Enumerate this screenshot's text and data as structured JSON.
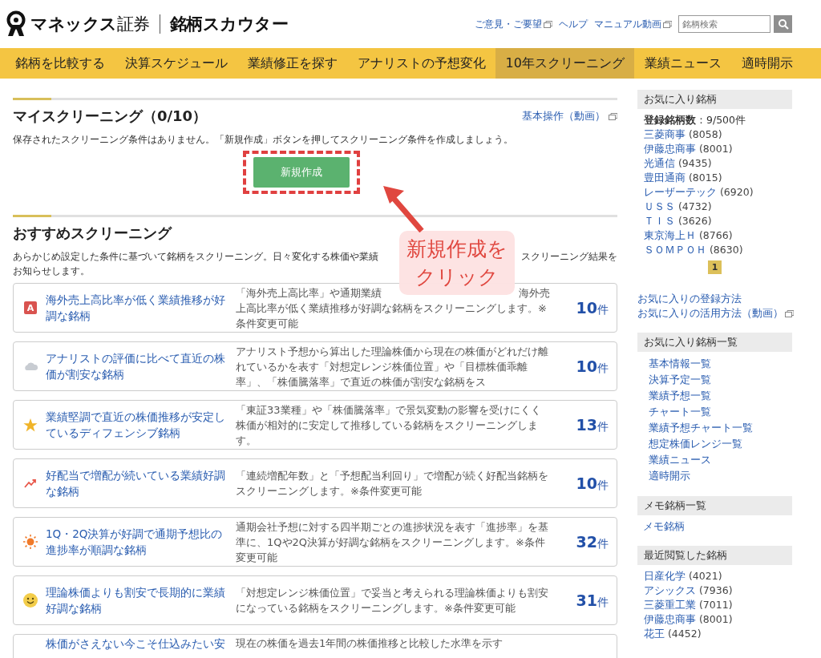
{
  "header": {
    "brand": "**マネックス**証券",
    "product": "銘柄スカウター",
    "links": [
      {
        "label": "ご意見・ご要望",
        "external": true
      },
      {
        "label": "ヘルプ",
        "external": false
      },
      {
        "label": "マニュアル動画",
        "external": true
      }
    ],
    "search": {
      "placeholder": "銘柄検索"
    }
  },
  "nav": [
    {
      "label": "銘柄を比較する",
      "selected": false
    },
    {
      "label": "決算スケジュール",
      "selected": false
    },
    {
      "label": "業績修正を探す",
      "selected": false
    },
    {
      "label": "アナリストの予想変化",
      "selected": false
    },
    {
      "label": "10年スクリーニング",
      "selected": true
    },
    {
      "label": "業績ニュース",
      "selected": false
    },
    {
      "label": "適時開示",
      "selected": false
    }
  ],
  "my_screening": {
    "title": "マイスクリーニング（0/10）",
    "help_link": "基本操作（動画）",
    "message": "保存されたスクリーニング条件はありません。「新規作成」ボタンを押してスクリーニング条件を作成しましょう。",
    "button": "新規作成"
  },
  "recommended": {
    "title": "おすすめスクリーニング",
    "intro": [
      "あらかじめ設定した条件に基づいて銘柄をスクリーニング。日々変化する株価や業績",
      "スクリーニング結果を",
      "お知らせします。"
    ],
    "items": [
      {
        "kind": "letter",
        "icon_text": "A",
        "title": "海外売上高比率が低く業績推移が好調な銘柄",
        "description": [
          "「海外売上高比率」や通期業績",
          "海外売",
          "上高比率が低く業績推移が好調な銘柄をスクリーニングします。※条件変更可能"
        ],
        "count": "10",
        "unit": "件"
      },
      {
        "kind": "cloud",
        "title": "アナリストの評価に比べて直近の株価が割安な銘柄",
        "description": [
          "アナリスト予想から算出した理論株価から現在の株価がどれだけ離れているかを表す「対想定レンジ株価位置」や「目標株価乖離率」、「株価騰落率」で直近の株価が割安な銘柄をス"
        ],
        "count": "10",
        "unit": "件"
      },
      {
        "kind": "star",
        "title": "業績堅調で直近の株価推移が安定しているディフェンシブ銘柄",
        "description": [
          "「東証33業種」や「株価騰落率」で景気変動の影響を受けにくく株価が相対的に安定して推移している銘柄をスクリーニングします。"
        ],
        "count": "13",
        "unit": "件"
      },
      {
        "kind": "trend",
        "title": "好配当で増配が続いている業績好調な銘柄",
        "description": [
          "「連続増配年数」と「予想配当利回り」で増配が続く好配当銘柄をスクリーニングします。※条件変更可能"
        ],
        "count": "10",
        "unit": "件"
      },
      {
        "kind": "sun",
        "title": "1Q・2Q決算が好調で通期予想比の進捗率が順調な銘柄",
        "description": [
          "通期会社予想に対する四半期ごとの進捗状況を表す「進捗率」を基準に、1Qや2Q決算が好調な銘柄をスクリーニングします。※条件変更可能"
        ],
        "count": "32",
        "unit": "件"
      },
      {
        "kind": "smile",
        "title": "理論株価よりも割安で長期的に業績好調な銘柄",
        "description": [
          "「対想定レンジ株価位置」で妥当と考えられる理論株価よりも割安になっている銘柄をスクリーニングします。※条件変更可能"
        ],
        "count": "31",
        "unit": "件"
      },
      {
        "title": "株価がさえない今こそ仕込みたい安",
        "description": [
          "現在の株価を過去1年間の株価推移と比較した水準を示す"
        ]
      }
    ]
  },
  "callout": {
    "lines": [
      "新規作成を",
      "クリック"
    ]
  },
  "sidebar": {
    "favorites": {
      "title": "お気に入り銘柄",
      "count": "**登録銘柄数**：9/500件",
      "stocks": [
        {
          "name": "三菱商事",
          "code": "(8058)"
        },
        {
          "name": "伊藤忠商事",
          "code": "(8001)"
        },
        {
          "name": "光通信",
          "code": "(9435)"
        },
        {
          "name": "豊田通商",
          "code": "(8015)"
        },
        {
          "name": "レーザーテック",
          "code": "(6920)"
        },
        {
          "name": "ＵＳＳ",
          "code": "(4732)"
        },
        {
          "name": "ＴＩＳ",
          "code": "(3626)"
        },
        {
          "name": "東京海上Ｈ",
          "code": "(8766)"
        },
        {
          "name": "ＳＯＭＰＯＨ",
          "code": "(8630)"
        }
      ],
      "pages": [
        {
          "label": "1",
          "selected": true
        }
      ],
      "help_links": [
        {
          "label": "お気に入りの登録方法",
          "external": false
        },
        {
          "label": "お気に入りの活用方法（動画）",
          "external": true
        }
      ]
    },
    "favorite_lists": {
      "title": "お気に入り銘柄一覧",
      "links": [
        "基本情報一覧",
        "決算予定一覧",
        "業績予想一覧",
        "チャート一覧",
        "業績予想チャート一覧",
        "想定株価レンジ一覧",
        "業績ニュース",
        "適時開示"
      ]
    },
    "memo": {
      "title": "メモ銘柄一覧",
      "links": [
        "メモ銘柄"
      ]
    },
    "recent": {
      "title": "最近閲覧した銘柄",
      "stocks": [
        {
          "name": "日産化学",
          "code": "(4021)"
        },
        {
          "name": "アシックス",
          "code": "(7936)"
        },
        {
          "name": "三菱重工業",
          "code": "(7011)"
        },
        {
          "name": "伊藤忠商事",
          "code": "(8001)"
        },
        {
          "name": "花王",
          "code": "(4452)"
        }
      ]
    }
  }
}
